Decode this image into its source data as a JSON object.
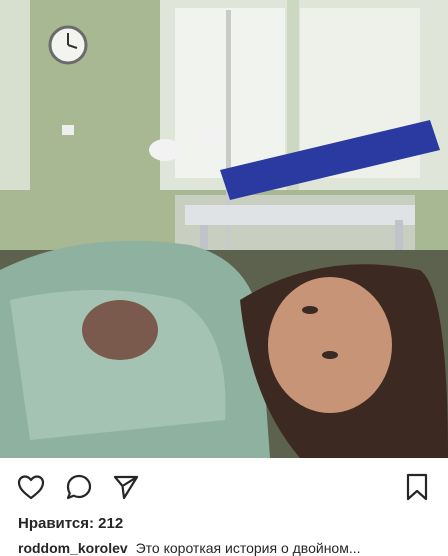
{
  "post": {
    "likes_label": "Нравится: 212",
    "caption_user": "roddom_korolev",
    "caption_text": "Это короткая история о двойном..."
  },
  "icons": {
    "like": "heart-icon",
    "comment": "comment-bubble-icon",
    "share": "paper-plane-icon",
    "save": "bookmark-icon"
  },
  "colors": {
    "icon_stroke": "#262626",
    "text": "#262626",
    "wall": "#a9bb93",
    "blanket": "#8fb1a0"
  }
}
